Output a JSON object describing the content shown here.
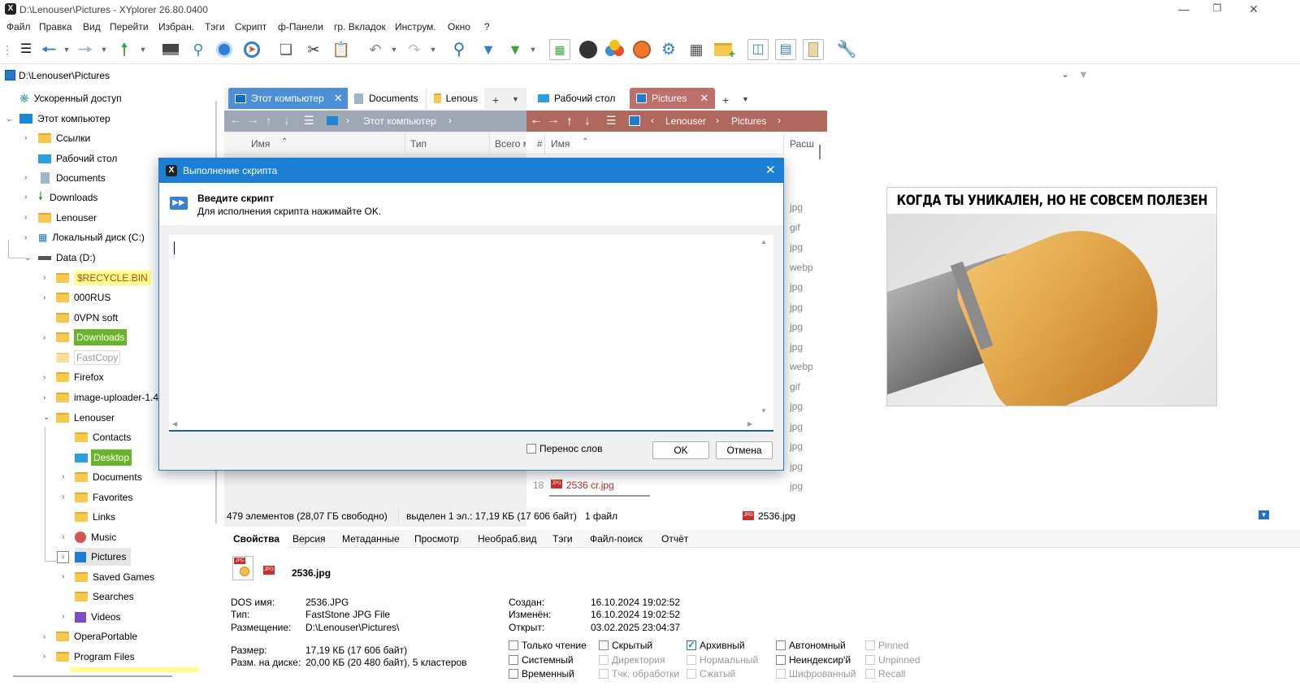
{
  "window": {
    "title": "D:\\Lenouser\\Pictures - XYplorer 26.80.0400",
    "app_icon": "X"
  },
  "menu": [
    "Файл",
    "Правка",
    "Вид",
    "Перейти",
    "Избран.",
    "Тэги",
    "Скрипт",
    "ф-Панели",
    "гр. Вкладок",
    "Инструм.",
    "Окно",
    "?"
  ],
  "address": {
    "path": "D:\\Lenouser\\Pictures"
  },
  "tree": {
    "items": [
      {
        "label": "Ускоренный доступ"
      },
      {
        "label": "Этот компьютер"
      },
      {
        "label": "Ссылки"
      },
      {
        "label": "Рабочий стол"
      },
      {
        "label": "Documents"
      },
      {
        "label": "Downloads"
      },
      {
        "label": "Lenouser"
      },
      {
        "label": "Локальный диск (C:)"
      },
      {
        "label": "Data (D:)"
      },
      {
        "label": "$RECYCLE.BIN"
      },
      {
        "label": "000RUS"
      },
      {
        "label": "0VPN soft"
      },
      {
        "label": "Downloads"
      },
      {
        "label": "FastCopy"
      },
      {
        "label": "Firefox"
      },
      {
        "label": "image-uploader-1.4."
      },
      {
        "label": "Lenouser"
      },
      {
        "label": "Contacts"
      },
      {
        "label": "Desktop"
      },
      {
        "label": "Documents"
      },
      {
        "label": "Favorites"
      },
      {
        "label": "Links"
      },
      {
        "label": "Music"
      },
      {
        "label": "Pictures"
      },
      {
        "label": "Saved Games"
      },
      {
        "label": "Searches"
      },
      {
        "label": "Videos"
      },
      {
        "label": "OperaPortable"
      },
      {
        "label": "Program Files"
      }
    ]
  },
  "pane1": {
    "tabs": [
      "Этот компьютер",
      "Documents",
      "Lenous"
    ],
    "breadcrumb": [
      "Этот компьютер"
    ],
    "columns": [
      "Имя",
      "Тип",
      "Всего м"
    ]
  },
  "pane2": {
    "tabs": [
      "Рабочий стол",
      "Pictures"
    ],
    "breadcrumb": [
      "Lenouser",
      "Pictures"
    ],
    "columns": [
      "#",
      "Имя",
      "Расш"
    ],
    "extensions": [
      "jpg",
      "gif",
      "jpg",
      "webp",
      "jpg",
      "jpg",
      "jpg",
      "jpg",
      "webp",
      "gif",
      "jpg",
      "jpg",
      "jpg",
      "jpg",
      "jpg"
    ],
    "last_row": {
      "num": "18",
      "name": "2536 cr.jpg"
    }
  },
  "dialog": {
    "title": "Выполнение скрипта",
    "heading": "Введите скрипт",
    "subheading": "Для исполнения скрипта нажимайте OK.",
    "wrap_label": "Перенос слов",
    "ok": "OK",
    "cancel": "Отмена"
  },
  "preview": {
    "caption": "КОГДА ТЫ УНИКАЛЕН, НО НЕ СОВСЕМ ПОЛЕЗЕН"
  },
  "status": {
    "left": "479 элементов (28,07 ГБ свободно)",
    "mid": "выделен 1 эл.: 17,19 КБ (17 606 байт)   1 файл",
    "file": "2536.jpg"
  },
  "info_tabs": [
    "Свойства",
    "Версия",
    "Метаданные",
    "Просмотр",
    "Необраб.вид",
    "Тэги",
    "Файл-поиск",
    "Отчёт"
  ],
  "file_info": {
    "name": "2536.jpg",
    "rows_left": [
      {
        "k": "DOS имя:",
        "v": "2536.JPG"
      },
      {
        "k": "Тип:",
        "v": "FastStone JPG File"
      },
      {
        "k": "Размещение:",
        "v": "D:\\Lenouser\\Pictures\\"
      },
      {
        "k": "Размер:",
        "v": "17,19 КБ (17 606 байт)"
      },
      {
        "k": "Разм. на диске:",
        "v": "20,00 КБ (20 480 байт), 5 кластеров"
      }
    ],
    "rows_right": [
      {
        "k": "Создан:",
        "v": "16.10.2024 19:02:52"
      },
      {
        "k": "Изменён:",
        "v": "16.10.2024 19:02:52"
      },
      {
        "k": "Открыт:",
        "v": "03.02.2025 23:04:37"
      }
    ],
    "attributes": [
      {
        "label": "Только чтение",
        "checked": false,
        "disabled": false
      },
      {
        "label": "Системный",
        "checked": false,
        "disabled": false
      },
      {
        "label": "Временный",
        "checked": false,
        "disabled": false
      },
      {
        "label": "Скрытый",
        "checked": false,
        "disabled": false
      },
      {
        "label": "Директория",
        "checked": false,
        "disabled": true
      },
      {
        "label": "Тчк. обработки",
        "checked": false,
        "disabled": true
      },
      {
        "label": "Архивный",
        "checked": true,
        "disabled": false
      },
      {
        "label": "Нормальный",
        "checked": false,
        "disabled": true
      },
      {
        "label": "Сжатый",
        "checked": false,
        "disabled": true
      },
      {
        "label": "Автономный",
        "checked": false,
        "disabled": false
      },
      {
        "label": "Неиндексир'й",
        "checked": false,
        "disabled": false
      },
      {
        "label": "Шифрованный",
        "checked": false,
        "disabled": true
      },
      {
        "label": "Pinned",
        "checked": false,
        "disabled": true
      },
      {
        "label": "Unpinned",
        "checked": false,
        "disabled": true
      },
      {
        "label": "Recall",
        "checked": false,
        "disabled": true
      }
    ]
  },
  "colors": {
    "accent": "#1b7fd5",
    "tab_active_1": "#4d8fd6",
    "tab_active_2": "#c0706a",
    "highlight_yellow": "#ffff8a",
    "highlight_green": "#6ab42a"
  }
}
